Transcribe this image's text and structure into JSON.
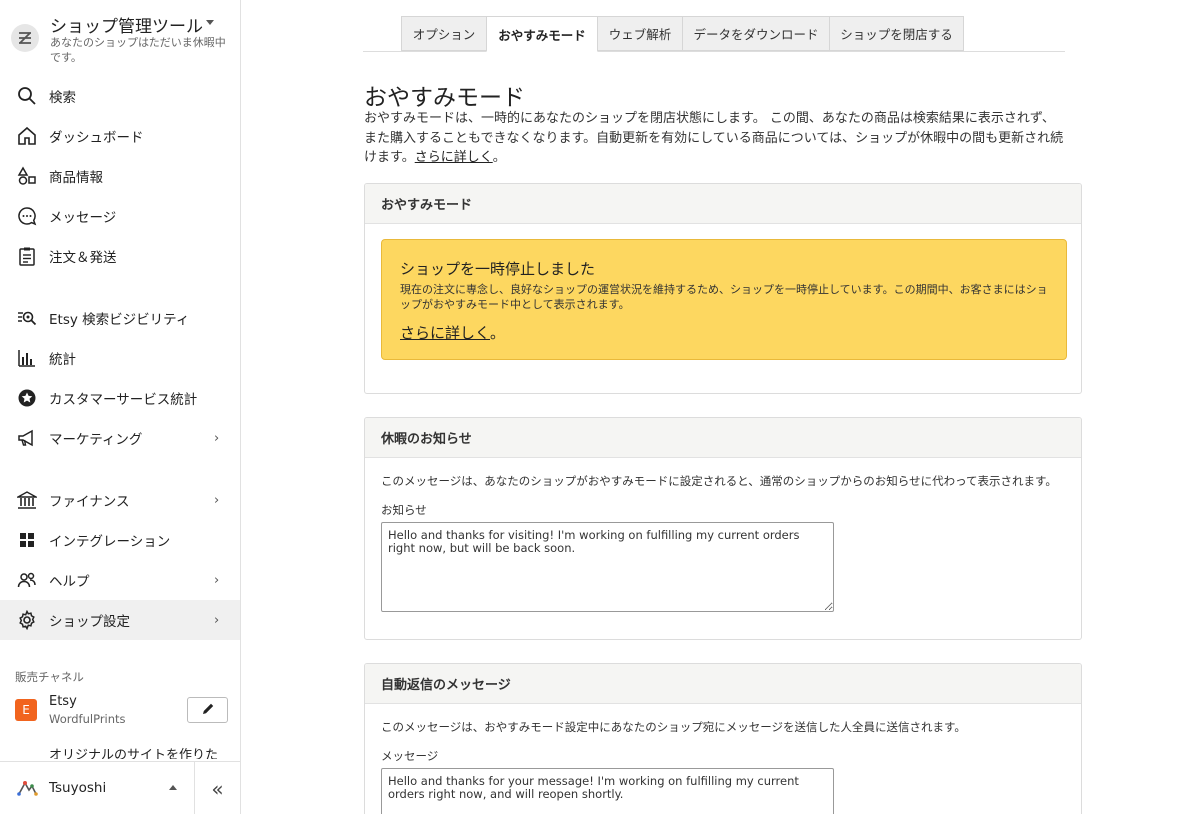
{
  "sidebar": {
    "title": "ショップ管理ツール",
    "subtitle": "あなたのショップはただいま休暇中です。",
    "nav": [
      {
        "label": "検索"
      },
      {
        "label": "ダッシュボード"
      },
      {
        "label": "商品情報"
      },
      {
        "label": "メッセージ"
      },
      {
        "label": "注文＆発送"
      },
      {
        "label": "Etsy 検索ビジビリティ"
      },
      {
        "label": "統計"
      },
      {
        "label": "カスタマーサービス統計"
      },
      {
        "label": "マーケティング"
      },
      {
        "label": "ファイナンス"
      },
      {
        "label": "インテグレーション"
      },
      {
        "label": "ヘルプ"
      },
      {
        "label": "ショップ設定"
      }
    ],
    "sales_channels_label": "販売チャネル",
    "channel": {
      "badge": "E",
      "name": "Etsy",
      "shop": "WordfulPrints"
    },
    "cut_text": "オリジナルのサイトを作りた",
    "user": {
      "name": "Tsuyoshi"
    },
    "collapse_glyph": "«"
  },
  "tabs": [
    {
      "label": "オプション"
    },
    {
      "label": "おやすみモード"
    },
    {
      "label": "ウェブ解析"
    },
    {
      "label": "データをダウンロード"
    },
    {
      "label": "ショップを閉店する"
    }
  ],
  "main": {
    "title": "おやすみモード",
    "description": "おやすみモードは、一時的にあなたのショップを閉店状態にします。 この間、あなたの商品は検索結果に表示されず、また購入することもできなくなります。自動更新を有効にしている商品については、ショップが休暇中の間も更新され続けます。",
    "learn_more": "さらに詳しく",
    "period": "。"
  },
  "vacation_panel": {
    "header": "おやすみモード",
    "alert_title": "ショップを一時停止しました",
    "alert_body": "現在の注文に専念し、良好なショップの運営状況を維持するため、ショップを一時停止しています。この期間中、お客さまにはショップがおやすみモード中として表示されます。",
    "alert_link": "さらに詳しく",
    "alert_period": "。"
  },
  "notice_panel": {
    "header": "休暇のお知らせ",
    "description": "このメッセージは、あなたのショップがおやすみモードに設定されると、通常のショップからのお知らせに代わって表示されます。",
    "field_label": "お知らせ",
    "value": "Hello and thanks for visiting! I'm working on fulfilling my current orders right now, but will be back soon."
  },
  "autoreply_panel": {
    "header": "自動返信のメッセージ",
    "description": "このメッセージは、おやすみモード設定中にあなたのショップ宛にメッセージを送信した人全員に送信されます。",
    "field_label": "メッセージ",
    "value": "Hello and thanks for your message! I'm working on fulfilling my current orders right now, and will reopen shortly."
  },
  "colors": {
    "alert_bg": "#fdd760",
    "etsy_orange": "#f1641e",
    "active_nav": "#f0f0f0"
  }
}
